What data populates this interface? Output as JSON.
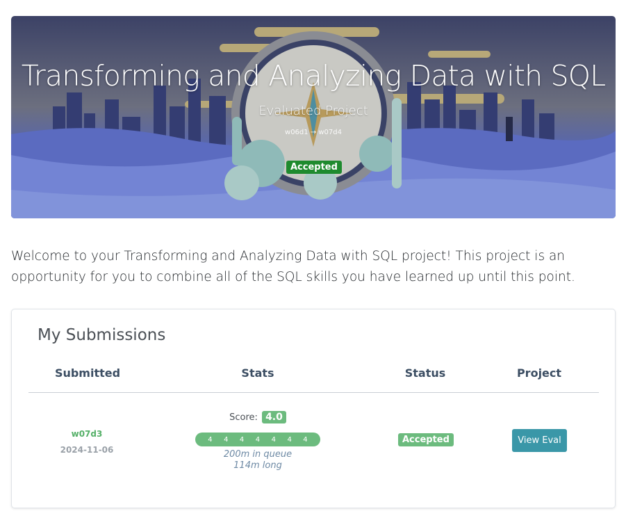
{
  "hero": {
    "title": "Transforming and Analyzing Data with SQL",
    "subtitle": "Evaluated Project",
    "range": "w06d1 → w07d4",
    "status": "Accepted"
  },
  "intro": "Welcome to your Transforming and Analyzing Data with SQL project! This project is an opportunity for you to combine all of the SQL skills you have learned up until this point.",
  "submissions": {
    "title": "My Submissions",
    "columns": [
      "Submitted",
      "Stats",
      "Status",
      "Project"
    ],
    "rows": [
      {
        "version": "w07d3",
        "date": "2024-11-06",
        "score_label": "Score:",
        "score": "4.0",
        "criteria": [
          "4",
          "4",
          "4",
          "4",
          "4",
          "4",
          "4"
        ],
        "queue": "200m in queue",
        "duration": "114m long",
        "status": "Accepted",
        "action": "View Eval"
      }
    ]
  },
  "colors": {
    "accepted": "#6cbb7e",
    "hero_badge": "#1e8a2e",
    "button": "#3a97a8"
  }
}
